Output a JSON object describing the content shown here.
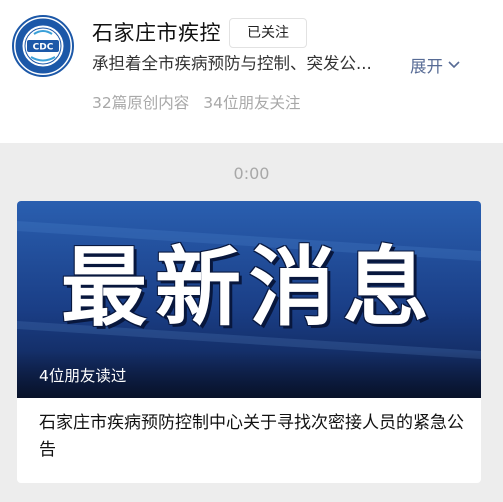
{
  "account": {
    "name": "石家庄市疾控",
    "follow_button": "已关注",
    "description": "承担着全市疾病预防与控制、突发公...",
    "expand_label": "展开",
    "stats": {
      "original": "32篇原创内容",
      "followers": "34位朋友关注"
    },
    "avatar_text": "CDC"
  },
  "audio": {
    "time": "0:00"
  },
  "article": {
    "cover_text": "最新消息",
    "readers": "4位朋友读过",
    "title": "石家庄市疾病预防控制中心关于寻找次密接人员的紧急公告"
  },
  "colors": {
    "link": "#576b95",
    "cover_blue": "#1a3e86",
    "background": "#ededed"
  },
  "icons": {
    "expand": "chevron-down-icon"
  }
}
